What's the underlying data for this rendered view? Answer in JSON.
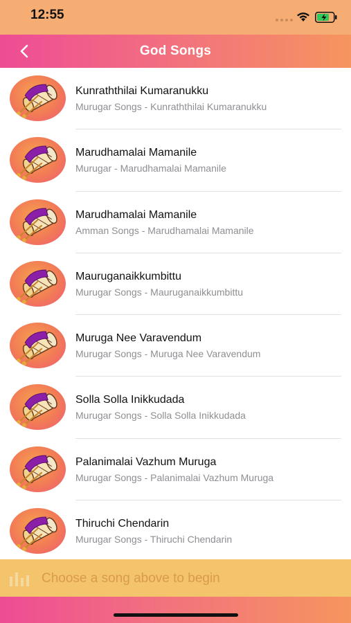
{
  "status_bar": {
    "time": "12:55"
  },
  "nav": {
    "title": "God Songs",
    "back_icon": "chevron-left-icon"
  },
  "songs": [
    {
      "title": "Kunraththilai Kumaranukku",
      "subtitle": "Murugar Songs - Kunraththilai Kumaranukku"
    },
    {
      "title": "Marudhamalai Mamanile",
      "subtitle": "Murugar - Marudhamalai Mamanile"
    },
    {
      "title": "Marudhamalai Mamanile",
      "subtitle": "Amman Songs - Marudhamalai Mamanile"
    },
    {
      "title": "Mauruganaikkumbittu",
      "subtitle": "Murugar Songs - Mauruganaikkumbittu"
    },
    {
      "title": "Muruga Nee Varavendum",
      "subtitle": "Murugar Songs - Muruga Nee Varavendum"
    },
    {
      "title": "Solla Solla Inikkudada",
      "subtitle": "Murugar Songs - Solla Solla Inikkudada"
    },
    {
      "title": "Palanimalai Vazhum Muruga",
      "subtitle": "Murugar Songs - Palanimalai Vazhum Muruga"
    },
    {
      "title": "Thiruchi Chendarin",
      "subtitle": "Murugar Songs - Thiruchi Chendarin"
    }
  ],
  "player": {
    "prompt": "Choose a song above to begin",
    "icon": "equalizer-bars-icon"
  },
  "colors": {
    "accent_pink": "#ee4c95",
    "accent_orange": "#f6955f",
    "player_bg": "#f3c46c"
  }
}
